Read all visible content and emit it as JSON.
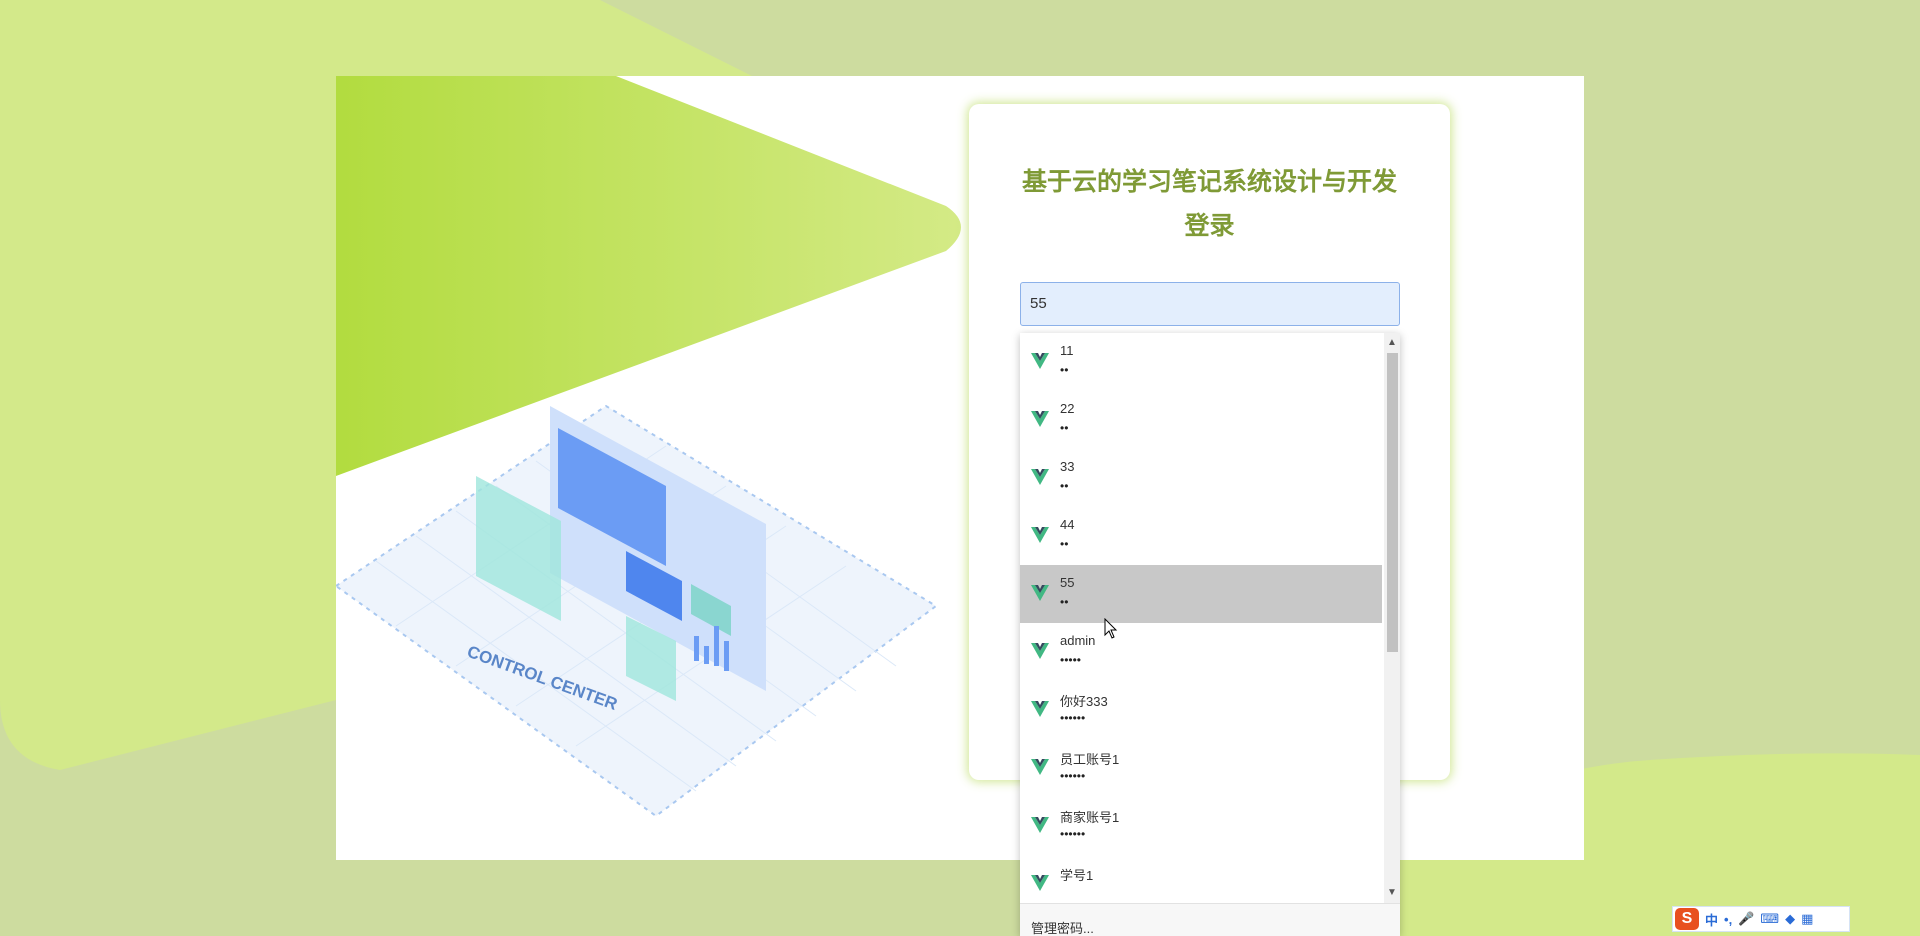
{
  "login": {
    "title_line1": "基于云的学习笔记系统设计与开发",
    "title_line2": "登录"
  },
  "username_input": {
    "value": "55"
  },
  "autocomplete": {
    "items": [
      {
        "username": "11",
        "password_mask": "••"
      },
      {
        "username": "22",
        "password_mask": "••"
      },
      {
        "username": "33",
        "password_mask": "••"
      },
      {
        "username": "44",
        "password_mask": "••"
      },
      {
        "username": "55",
        "password_mask": "••"
      },
      {
        "username": "admin",
        "password_mask": "•••••"
      },
      {
        "username": "你好333",
        "password_mask": "••••••"
      },
      {
        "username": "员工账号1",
        "password_mask": "••••••"
      },
      {
        "username": "商家账号1",
        "password_mask": "••••••"
      },
      {
        "username": "学号1",
        "password_mask": ""
      }
    ],
    "selected_index": 4,
    "manage_label": "管理密码..."
  },
  "illustration": {
    "label": "CONTROL CENTER"
  },
  "ime": {
    "logo": "S",
    "mode": "中",
    "punct": "•,",
    "icons": [
      "mic-icon",
      "keyboard-icon",
      "shirt-icon",
      "grid-icon"
    ]
  },
  "colors": {
    "accent_green": "#b4dc44",
    "title_green": "#7f9a36",
    "page_bg": "#cddc9f"
  }
}
